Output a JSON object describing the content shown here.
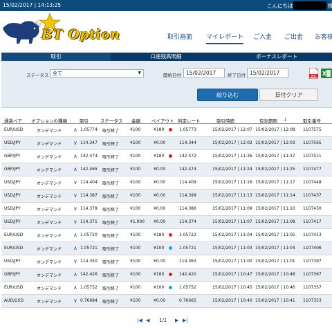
{
  "topbar": {
    "datetime": "15/02/2017 | 14:13:25",
    "greeting": "こんにちは",
    "suffix": "様"
  },
  "logo": {
    "text": "BT Option"
  },
  "nav": {
    "items": [
      {
        "label": "取引画面",
        "active": false
      },
      {
        "label": "マイレポート",
        "active": true
      },
      {
        "label": "ご入金",
        "active": false
      },
      {
        "label": "ご出金",
        "active": false
      },
      {
        "label": "お客様",
        "active": false
      }
    ]
  },
  "subtabs": [
    {
      "label": "取引",
      "active": true
    },
    {
      "label": "口座残高明細",
      "active": false
    },
    {
      "label": "ボーナスレポート",
      "active": false
    }
  ],
  "filter": {
    "status_label": "ステータス",
    "status_value": "全て",
    "start_label": "開始日付",
    "start_value": "15/02/2017",
    "end_label": "終了日付",
    "end_value": "15/02/2017",
    "search_button": "絞り込む",
    "clear_button": "日付クリア"
  },
  "table": {
    "headers": [
      "通貨ペア",
      "オプションの種類",
      "取引",
      "ステータス",
      "金額",
      "ペイアウト",
      "判定レート",
      "取引時間",
      "有効期限",
      "取引番号"
    ],
    "sort_indicator": "↓",
    "rows": [
      {
        "pair": "EUR/USD",
        "type": "オンデマンド",
        "dir": "up",
        "rate": "1.05774",
        "status": "取引終了",
        "amount": "¥100",
        "payout": "¥180",
        "dot": "red",
        "close": "1.05773",
        "time": "15/02/2017 | 12:07",
        "expiry": "15/02/2017 | 12:08",
        "id": "1107575"
      },
      {
        "pair": "USD/JPY",
        "type": "オンデマンド",
        "dir": "down",
        "rate": "114.347",
        "status": "取引終了",
        "amount": "¥100",
        "payout": "¥0.00",
        "dot": "",
        "close": "114.344",
        "time": "15/02/2017 | 12:02",
        "expiry": "15/02/2017 | 12:03",
        "id": "1107565"
      },
      {
        "pair": "GBP/JPY",
        "type": "オンデマンド",
        "dir": "up",
        "rate": "142.474",
        "status": "取引終了",
        "amount": "¥100",
        "payout": "¥180",
        "dot": "red",
        "close": "142.472",
        "time": "15/02/2017 | 11:36",
        "expiry": "15/02/2017 | 11:37",
        "id": "1107511"
      },
      {
        "pair": "GBP/JPY",
        "type": "オンデマンド",
        "dir": "up",
        "rate": "142.465",
        "status": "取引終了",
        "amount": "¥100",
        "payout": "¥0.00",
        "dot": "",
        "close": "142.474",
        "time": "15/02/2017 | 11:24",
        "expiry": "15/02/2017 | 11:25",
        "id": "1107477"
      },
      {
        "pair": "USD/JPY",
        "type": "オンデマンド",
        "dir": "down",
        "rate": "114.404",
        "status": "取引終了",
        "amount": "¥100",
        "payout": "¥0.00",
        "dot": "",
        "close": "114.409",
        "time": "15/02/2017 | 11:16",
        "expiry": "15/02/2017 | 11:17",
        "id": "1107448"
      },
      {
        "pair": "USD/JPY",
        "type": "オンデマンド",
        "dir": "down",
        "rate": "114.387",
        "status": "取引終了",
        "amount": "¥100",
        "payout": "¥0.00",
        "dot": "",
        "close": "114.399",
        "time": "15/02/2017 | 11:13",
        "expiry": "15/02/2017 | 11:14",
        "id": "1107437"
      },
      {
        "pair": "USD/JPY",
        "type": "オンデマンド",
        "dir": "down",
        "rate": "114.378",
        "status": "取引終了",
        "amount": "¥100",
        "payout": "¥0.00",
        "dot": "",
        "close": "114.386",
        "time": "15/02/2017 | 11:09",
        "expiry": "15/02/2017 | 11:10",
        "id": "1107430"
      },
      {
        "pair": "USD/JPY",
        "type": "オンデマンド",
        "dir": "down",
        "rate": "114.371",
        "status": "取引終了",
        "amount": "¥1,000",
        "payout": "¥0.00",
        "dot": "",
        "close": "114.374",
        "time": "15/02/2017 | 11:07",
        "expiry": "15/02/2017 | 11:08",
        "id": "1107417"
      },
      {
        "pair": "EUR/USD",
        "type": "オンデマンド",
        "dir": "up",
        "rate": "1.05720",
        "status": "取引終了",
        "amount": "¥100",
        "payout": "¥180",
        "dot": "red",
        "close": "1.05722",
        "time": "15/02/2017 | 11:04",
        "expiry": "15/02/2017 | 11:05",
        "id": "1107413"
      },
      {
        "pair": "EUR/USD",
        "type": "オンデマンド",
        "dir": "up",
        "rate": "1.05721",
        "status": "取引終了",
        "amount": "¥100",
        "payout": "¥100",
        "dot": "blue",
        "close": "1.05721",
        "time": "15/02/2017 | 11:03",
        "expiry": "15/02/2017 | 11:04",
        "id": "1107406"
      },
      {
        "pair": "USD/JPY",
        "type": "オンデマンド",
        "dir": "down",
        "rate": "114.350",
        "status": "取引終了",
        "amount": "¥100",
        "payout": "¥0.00",
        "dot": "",
        "close": "114.363",
        "time": "15/02/2017 | 11:00",
        "expiry": "15/02/2017 | 11:01",
        "id": "1107397"
      },
      {
        "pair": "GBP/JPY",
        "type": "オンデマンド",
        "dir": "up",
        "rate": "142.426",
        "status": "取引終了",
        "amount": "¥100",
        "payout": "¥180",
        "dot": "red",
        "close": "142.420",
        "time": "15/02/2017 | 10:47",
        "expiry": "15/02/2017 | 10:48",
        "id": "1107367"
      },
      {
        "pair": "EUR/USD",
        "type": "オンデマンド",
        "dir": "up",
        "rate": "1.05752",
        "status": "取引終了",
        "amount": "¥100",
        "payout": "¥100",
        "dot": "blue",
        "close": "1.05752",
        "time": "15/02/2017 | 10:45",
        "expiry": "15/02/2017 | 10:46",
        "id": "1107357"
      },
      {
        "pair": "AUD/USD",
        "type": "オンデマンド",
        "dir": "down",
        "rate": "0.76684",
        "status": "取引終了",
        "amount": "¥100",
        "payout": "¥0.00",
        "dot": "",
        "close": "0.76665",
        "time": "15/02/2017 | 10:40",
        "expiry": "15/02/2017 | 10:41",
        "id": "1107353"
      }
    ]
  },
  "pager": {
    "first": "|◀",
    "prev": "◀",
    "page": "1/1",
    "next": "▶",
    "last": "▶|"
  },
  "colors": {
    "topbar": "#0b4b7d",
    "brand_gold": "#f5c400",
    "accent_blue": "#1f6dae",
    "dot_red": "#e02020",
    "dot_blue": "#1ea0e6"
  },
  "icons": {
    "pdf": "pdf-icon",
    "excel": "excel-icon",
    "bull_logo": "bull-logo"
  }
}
